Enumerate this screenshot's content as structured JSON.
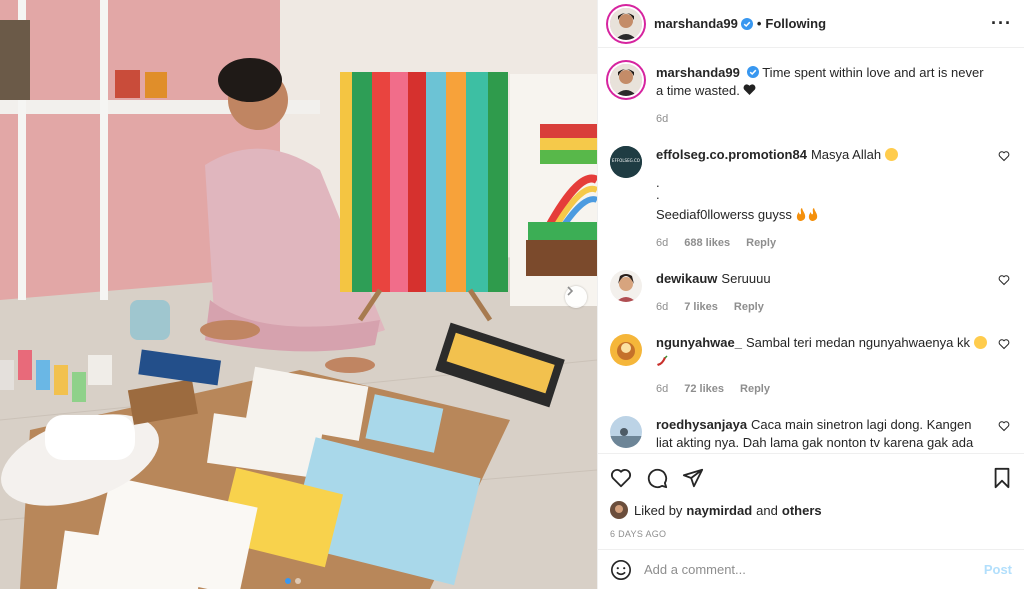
{
  "post": {
    "author": "marshanda99",
    "follow_state": "Following",
    "separator": "•",
    "caption": "Time spent within love and art is never a time wasted.",
    "caption_time": "6d",
    "more_glyph": "···"
  },
  "comments": [
    {
      "username": "effolseg.co.promotion84",
      "lines": [
        "Masya Allah",
        ".",
        ".",
        "Seediaf0llowerss guyss"
      ],
      "time": "6d",
      "likes": "688 likes",
      "reply": "Reply",
      "avatar_text": "EFFOLSEG.CO"
    },
    {
      "username": "dewikauw",
      "lines": [
        "Seruuuu"
      ],
      "time": "6d",
      "likes": "7 likes",
      "reply": "Reply"
    },
    {
      "username": "ngunyahwae_",
      "lines": [
        "Sambal teri medan ngunyahwaenya kk"
      ],
      "time": "6d",
      "likes": "72 likes",
      "reply": "Reply"
    },
    {
      "username": "roedhysanjaya",
      "lines": [
        "Caca main sinetron lagi dong. Kangen liat akting nya. Dah lama gak nonton tv karena gak ada kamu"
      ]
    }
  ],
  "likes_bar": {
    "prefix": "Liked by",
    "user": "naymirdad",
    "joiner": "and",
    "others": "others"
  },
  "posted_ago": "6 DAYS AGO",
  "composer": {
    "placeholder": "Add a comment...",
    "post_label": "Post"
  },
  "carousel": {
    "count": 2,
    "active": 1
  },
  "colors": {
    "text": "#262626",
    "muted": "#8e8e8e",
    "link_disabled": "#b2dffc",
    "verified": "#3897f0",
    "border": "#efefef"
  },
  "icons": [
    "verified-badge-icon",
    "more-options-icon",
    "heart-icon",
    "comment-icon",
    "share-icon",
    "bookmark-icon",
    "emoji-icon",
    "chevron-right-icon"
  ]
}
